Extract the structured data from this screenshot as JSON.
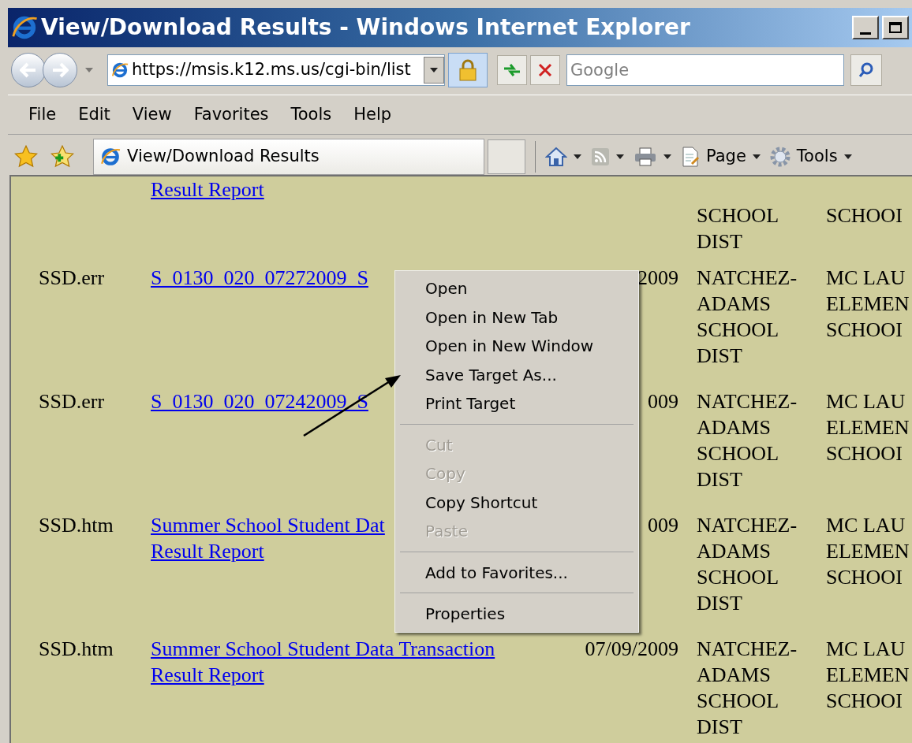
{
  "window": {
    "title": "View/Download Results - Windows Internet Explorer"
  },
  "address_bar": {
    "url": "https://msis.k12.ms.us/cgi-bin/list"
  },
  "search": {
    "placeholder": "Google"
  },
  "menu_bar": [
    "File",
    "Edit",
    "View",
    "Favorites",
    "Tools",
    "Help"
  ],
  "tab": {
    "title": "View/Download Results"
  },
  "command_bar": [
    {
      "kind": "home"
    },
    {
      "kind": "feeds"
    },
    {
      "kind": "print"
    },
    {
      "kind": "page",
      "label": "Page"
    },
    {
      "kind": "tools",
      "label": "Tools"
    }
  ],
  "rows": [
    {
      "type": "",
      "link": [
        "Result Report"
      ],
      "date": "",
      "district": [
        "SCHOOL",
        "DIST"
      ],
      "school": [
        "SCHOOI"
      ]
    },
    {
      "type": "SSD.err",
      "link": [
        "S_0130_020_07272009_S"
      ],
      "date": "2009",
      "district": [
        "NATCHEZ-",
        "ADAMS",
        "SCHOOL",
        "DIST"
      ],
      "school": [
        "MC LAU",
        "ELEMEN",
        "SCHOOI"
      ]
    },
    {
      "type": "SSD.err",
      "link": [
        "S_0130_020_07242009_S"
      ],
      "date": "009",
      "district": [
        "NATCHEZ-",
        "ADAMS",
        "SCHOOL",
        "DIST"
      ],
      "school": [
        "MC LAU",
        "ELEMEN",
        "SCHOOI"
      ]
    },
    {
      "type": "SSD.htm",
      "link": [
        "Summer School Student Dat",
        "Result Report"
      ],
      "date": "009",
      "district": [
        "NATCHEZ-",
        "ADAMS",
        "SCHOOL",
        "DIST"
      ],
      "school": [
        "MC LAU",
        "ELEMEN",
        "SCHOOI"
      ]
    },
    {
      "type": "SSD.htm",
      "link": [
        "Summer School Student Data Transaction",
        "Result Report"
      ],
      "date": "07/09/2009",
      "district": [
        "NATCHEZ-",
        "ADAMS",
        "SCHOOL",
        "DIST"
      ],
      "school": [
        "MC LAU",
        "ELEMEN",
        "SCHOOI"
      ]
    }
  ],
  "context_menu": [
    {
      "kind": "item",
      "label": "Open",
      "disabled": false
    },
    {
      "kind": "item",
      "label": "Open in New Tab",
      "disabled": false
    },
    {
      "kind": "item",
      "label": "Open in New Window",
      "disabled": false
    },
    {
      "kind": "item",
      "label": "Save Target As...",
      "disabled": false
    },
    {
      "kind": "item",
      "label": "Print Target",
      "disabled": false
    },
    {
      "kind": "separator"
    },
    {
      "kind": "item",
      "label": "Cut",
      "disabled": true
    },
    {
      "kind": "item",
      "label": "Copy",
      "disabled": true
    },
    {
      "kind": "item",
      "label": "Copy Shortcut",
      "disabled": false
    },
    {
      "kind": "item",
      "label": "Paste",
      "disabled": true
    },
    {
      "kind": "separator"
    },
    {
      "kind": "item",
      "label": "Add to Favorites...",
      "disabled": false
    },
    {
      "kind": "separator"
    },
    {
      "kind": "item",
      "label": "Properties",
      "disabled": false
    }
  ]
}
